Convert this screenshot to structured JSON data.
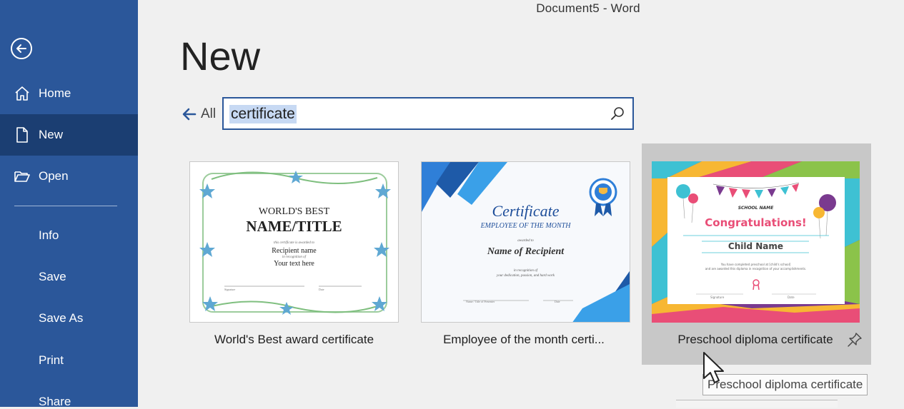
{
  "window": {
    "title": "Document5  -  Word"
  },
  "sidebar": {
    "back_icon": "back-arrow-circle-icon",
    "items": [
      {
        "label": "Home",
        "icon": "home-icon"
      },
      {
        "label": "New",
        "icon": "new-document-icon",
        "active": true
      },
      {
        "label": "Open",
        "icon": "folder-open-icon"
      }
    ],
    "sub_items": [
      "Info",
      "Save",
      "Save As",
      "Print",
      "Share"
    ],
    "background": "#2b579a",
    "active_background": "#1b3e72"
  },
  "main": {
    "heading": "New",
    "all_label": "All",
    "search": {
      "value": "certificate"
    }
  },
  "templates": [
    {
      "title": "World's Best award certificate",
      "preview": {
        "line1": "WORLD'S BEST",
        "line2": "NAME/TITLE",
        "line3": "this certificate is awarded to",
        "line4": "Recipient name",
        "line5": "in recognition of",
        "line6": "Your text here",
        "sig1": "Signature",
        "sig2": "Date"
      }
    },
    {
      "title": "Employee of the month certi...",
      "preview": {
        "line1": "Certificate",
        "line2": "EMPLOYEE OF THE MONTH",
        "line3": "awarded to",
        "line4": "Name of Recipient",
        "line5": "in recognition of",
        "line6": "your dedication, passion, and hard work",
        "sig1": "Name / Title of Presenter",
        "sig2": "Date"
      }
    },
    {
      "title": "Preschool diploma certificate",
      "preview": {
        "line1": "SCHOOL NAME",
        "line2": "Congratulations!",
        "line3": "Child Name",
        "line4": "You have completed preschool at [child's school]",
        "line5": "and are awarded this diploma in recognition of your accomplishments.",
        "sig1": "Signature",
        "sig2": "Date"
      },
      "hovered": true
    }
  ],
  "tooltip": {
    "text": "Preschool diploma certificate"
  }
}
